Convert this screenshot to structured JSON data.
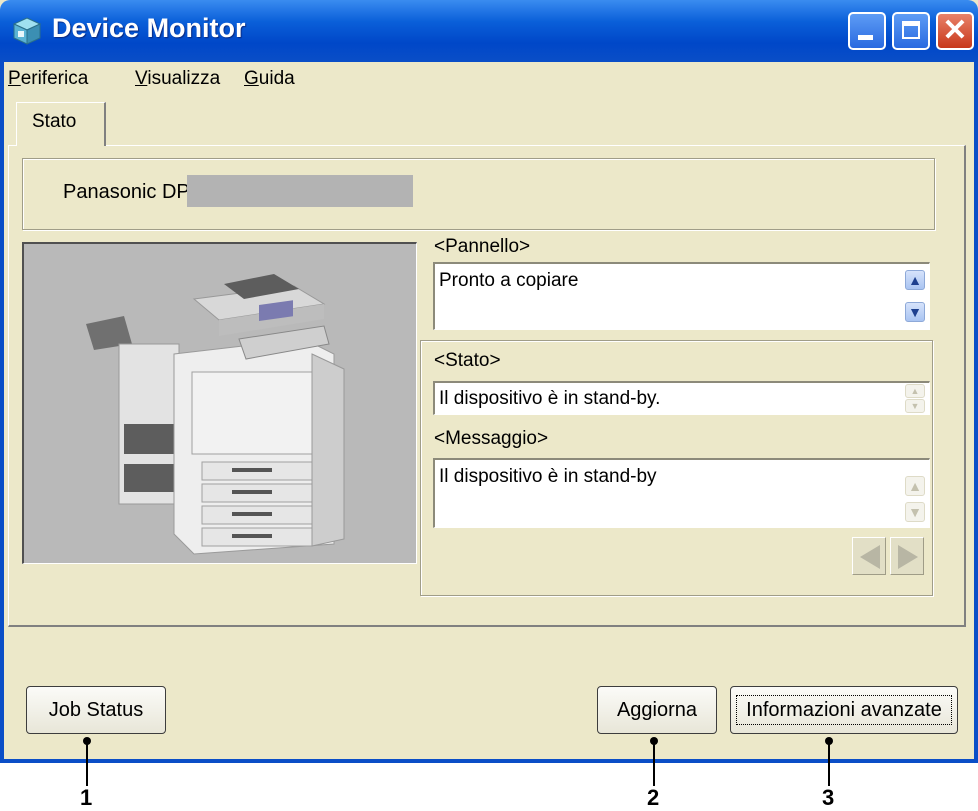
{
  "window": {
    "title": "Device Monitor",
    "icon": "device-monitor-icon",
    "controls": [
      "minimize",
      "maximize",
      "close"
    ]
  },
  "menu": {
    "items": [
      {
        "label": "Periferica"
      },
      {
        "label": "Visualizza"
      },
      {
        "label": "Guida"
      }
    ]
  },
  "tabs": [
    {
      "label": "Stato",
      "active": true
    }
  ],
  "device": {
    "model_prefix": "Panasonic DP"
  },
  "pannello": {
    "label": "<Pannello>",
    "value": "Pronto a copiare"
  },
  "stato": {
    "label": "<Stato>",
    "value": "Il dispositivo è in stand-by."
  },
  "messaggio": {
    "label": "<Messaggio>",
    "value": "Il dispositivo è in stand-by"
  },
  "buttons": {
    "job_status": "Job Status",
    "aggiorna": "Aggiorna",
    "informazioni": "Informazioni avanzate"
  },
  "callouts": [
    "1",
    "2",
    "3"
  ],
  "colors": {
    "titlebar": "#0a5fd9",
    "window_bg": "#ece8c9",
    "close_button": "#c8381a"
  }
}
